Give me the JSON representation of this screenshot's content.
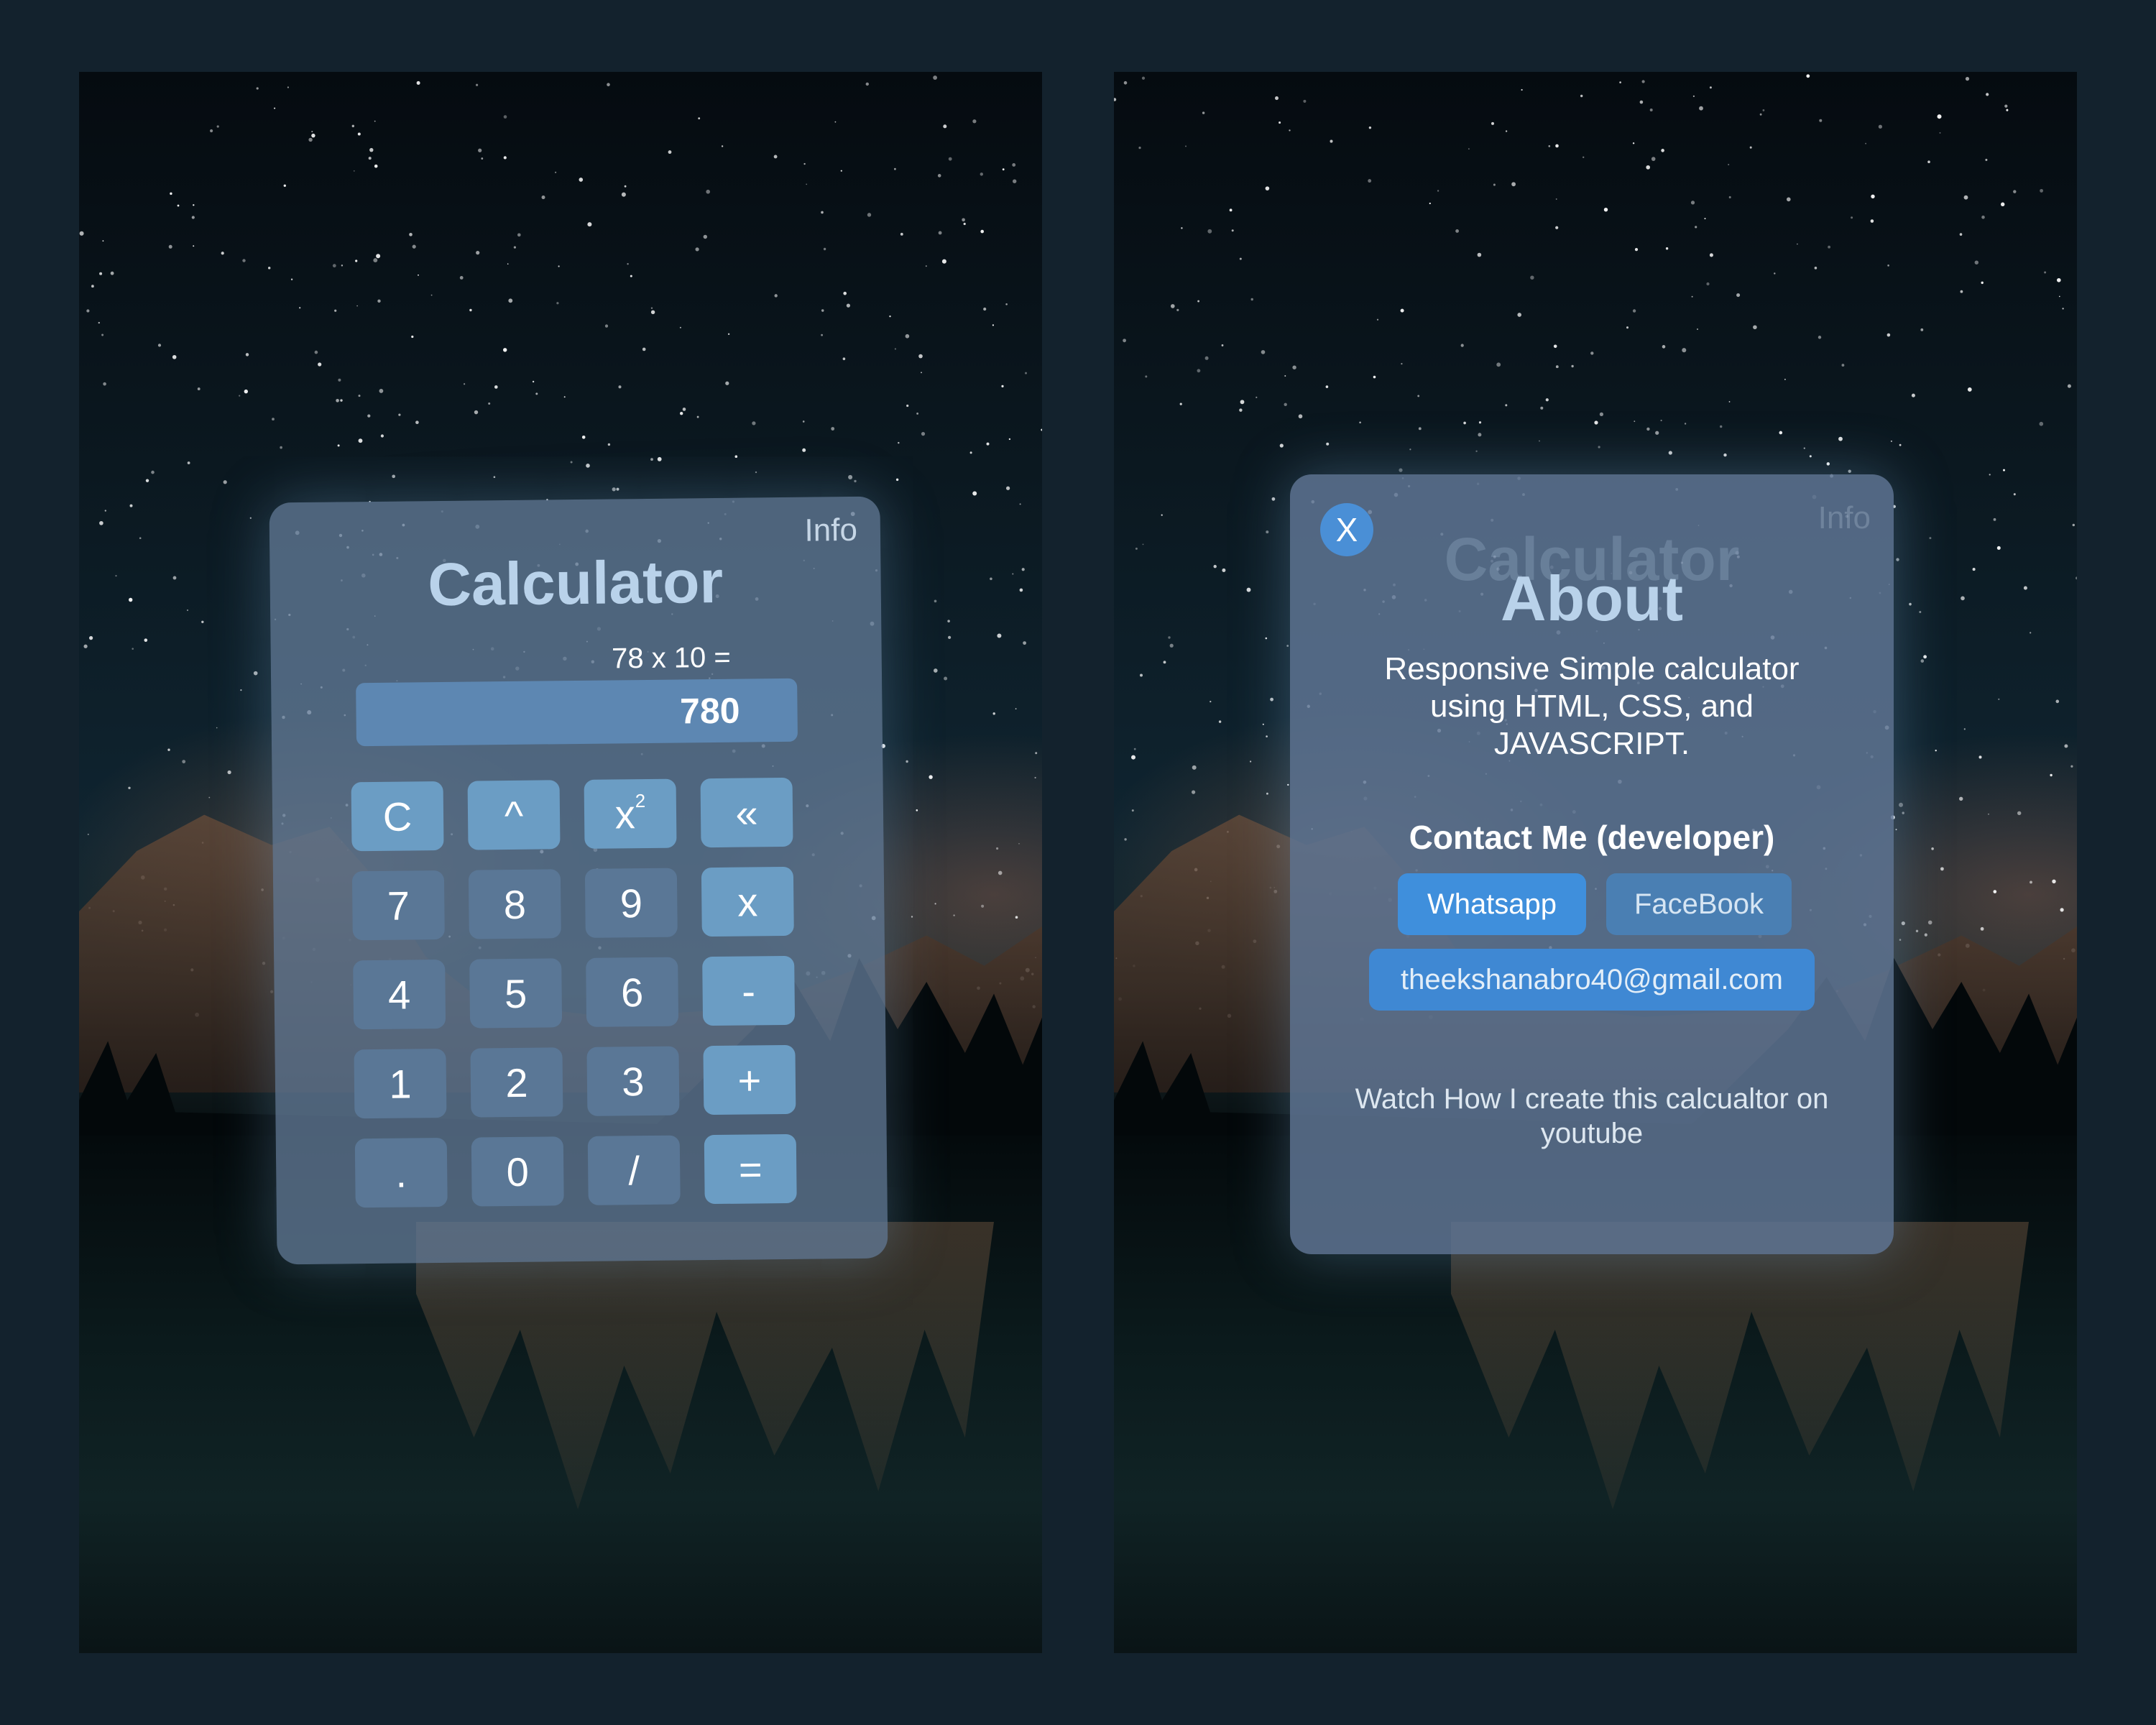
{
  "calculator": {
    "info_label": "Info",
    "title": "Calculator",
    "expression": "78 x 10 =",
    "display_value": "780",
    "keys": [
      {
        "label": "C",
        "name": "clear-key"
      },
      {
        "label": "^",
        "name": "power-key"
      },
      {
        "label": "x",
        "sup": "2",
        "name": "square-key"
      },
      {
        "label": "«",
        "name": "backspace-key"
      },
      {
        "label": "7",
        "name": "digit-7-key"
      },
      {
        "label": "8",
        "name": "digit-8-key"
      },
      {
        "label": "9",
        "name": "digit-9-key"
      },
      {
        "label": "x",
        "name": "multiply-key"
      },
      {
        "label": "4",
        "name": "digit-4-key"
      },
      {
        "label": "5",
        "name": "digit-5-key"
      },
      {
        "label": "6",
        "name": "digit-6-key"
      },
      {
        "label": "-",
        "name": "subtract-key"
      },
      {
        "label": "1",
        "name": "digit-1-key"
      },
      {
        "label": "2",
        "name": "digit-2-key"
      },
      {
        "label": "3",
        "name": "digit-3-key"
      },
      {
        "label": "+",
        "name": "add-key"
      },
      {
        "label": ".",
        "name": "decimal-key"
      },
      {
        "label": "0",
        "name": "digit-0-key"
      },
      {
        "label": "/",
        "name": "divide-key"
      },
      {
        "label": "=",
        "name": "equals-key"
      }
    ]
  },
  "about": {
    "close_label": "X",
    "title": "About",
    "description": "Responsive Simple calculator using HTML, CSS, and JAVASCRIPT.",
    "contact_heading": "Contact Me (developer)",
    "whatsapp_label": "Whatsapp",
    "facebook_label": "FaceBook",
    "email": "theekshanabro40@gmail.com",
    "youtube_text": "Watch How I create this calcualtor on youtube",
    "background_title": "Calculator",
    "background_info": "Info"
  },
  "colors": {
    "page_background": "#13222d",
    "card": "#627a96",
    "accent_blue": "#3f8fdc",
    "key_dark": "#5a7796",
    "key_light": "#6b9dc4"
  }
}
